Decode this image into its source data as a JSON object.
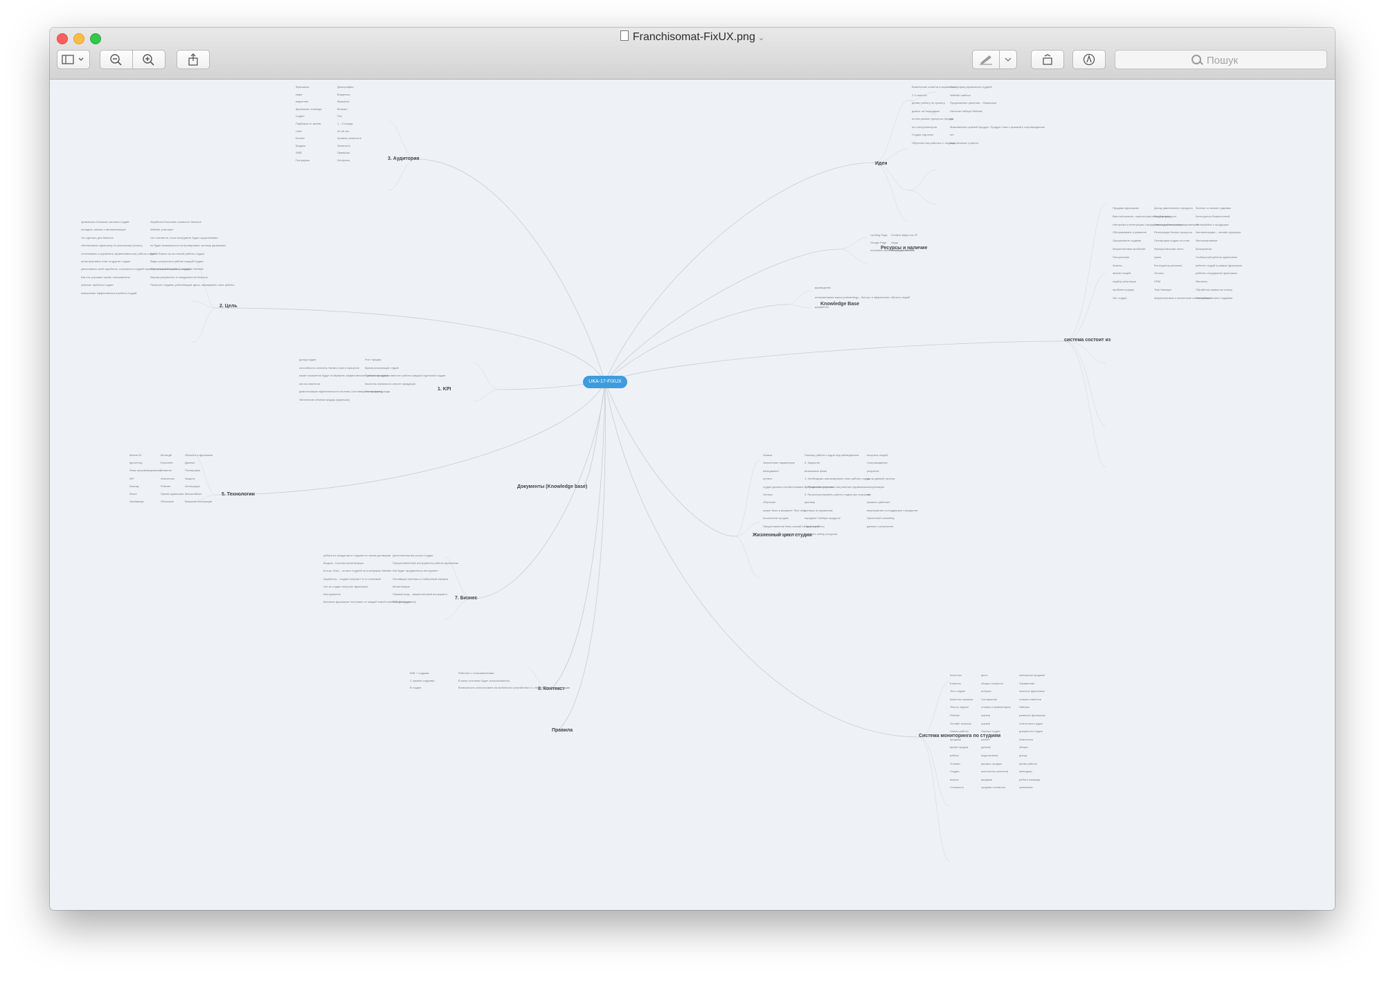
{
  "window": {
    "title": "Franchisomat-FixUX.png"
  },
  "search": {
    "placeholder": "Пошук"
  },
  "mindmap": {
    "center": "UKA-17-FIXUX",
    "main": {
      "idea": "Идея",
      "resources": "Ресурсы и наличие",
      "kb": "Knowledge Base",
      "system": "система состоит из",
      "lifecycle": "Жизненный цикл студии",
      "monitoring": "Система мониторинга по студиям",
      "auditory": "3. Аудитория",
      "goal": "2. Цель",
      "kpi": "1. KPI",
      "tech": "5. Технологии",
      "docs": "Документы (Knowledge base)",
      "business": "7. Бизнес",
      "context": "8. Контекст",
      "rules": "Правила"
    },
    "topics": {
      "idea": [
        "Вовлечение клиента в выражение",
        "2-3 клиента",
        "делает работу по проекту",
        "диалог на площадках",
        "не все разные процессы продаж",
        "нет консультаторов",
        "Студия под ключ",
        "Обучение как работать с людьми",
        "Платформа управления студией",
        "Website шаблон",
        "Продолжение решения – Франшиза",
        "Наличие наборы Website",
        "да",
        "Максимально краткий продукт; Продукт тоже с правкой к сопровождению",
        "нет",
        "подключение к работе"
      ],
      "resources": [
        "Landing Page",
        "Google Page",
        "основные записи на Front-end GS",
        "Готовое видео на JP",
        "Люди",
        "площадка Website"
      ],
      "kb": [
        "руководство",
        "интерактивная карта (onboarding) – быстро и эффективно обучить людей",
        "документы"
      ],
      "system": [
        "Продажа франшизы",
        "Ввести/показать, зарегистрировать доверие",
        "Настройка и интеграция стандартов студий на основе параметров",
        "Обслуживание и развитие",
        "Оформление студиям",
        "Маркетинговая проблема",
        "Поступление",
        "Анализ",
        "анализ людей",
        "подбор репутации",
        "проблем продаж",
        "Нет студии",
        "Доход фактического продукта",
        "Подбор продукта",
        "Заявка в планировщик",
        "Реализация бизнес-процесса",
        "Платформа студии по план",
        "Функциональная часть",
        "Цены",
        "Конструктор решения",
        "Оплата",
        "CRM",
        "Task Manager",
        "Маркетинговые и клиентские составляющие",
        "Контакт со всеми студиями",
        "Конструктор Вовлеченный",
        "Интерфейсы с продукции",
        "Автоматизация – онлайн-проверка",
        "Финансирование",
        "Калькулятор",
        "Глобальный рейтинг франчайзи",
        "рейтинг студий в рамках франшизы",
        "рейтинг сотрудников франшизы",
        "Финансы",
        "Обработка заявок на оплату",
        "Настройка оплаты студиями"
      ],
      "lifecycle": [
        "Заявка",
        "Заполнение параметров",
        "менеджмент",
        "оплата",
        "студия должна соответствовать требованиям качества",
        "Оплата",
        "Обучение",
        "может быть в формате \"Все-чём\"",
        "на качестве продаж",
        "Предоставление базы знаний по франшизе",
        "Оценка студии каждые сутки",
        "Помощь работы студии под наблюдением",
        "3. Закрытие",
        "возможные фазы",
        "1. Необходимо анализировать план работы студии за данный отрезок",
        "2. Продемонстрировать как работает франшиза",
        "3. Проконтролировать работу студии при открытии",
        "Договор",
        "договор по франшизе",
        "передача \"набора продукта\"",
        "Начало работы",
        "получить набор ресурсов",
        "получить людей",
        "Сопровождение",
        "результат",
        "да",
        "консультация",
        "нет",
        "правило работает",
        "мероприятия по поддержке стандартов",
        "Проектный consulting",
        "данные о результате"
      ],
      "monitoring": [
        "Качество",
        "Клиенты",
        "Тест студии",
        "Качество сервиса",
        "Тексты задачи",
        "Рейтинг",
        "Онлайн запросы",
        "Новые работы",
        "продажи",
        "время продаж",
        "работа",
        "Отзывы",
        "Студии",
        "вопрос",
        "Стоимость",
        "фото",
        "общая стоимость",
        "интерес",
        "Соглашение",
        "отзывы и комментарии",
        "оценка",
        "оценки",
        "Оценка студии",
        "расчёт",
        "данные",
        "подключение",
        "процесс продаж",
        "количество клиентов",
        "продажи",
        "средняя стоимость",
        "повторные продажи",
        "Управление",
        "клиенты франшизы",
        "отзывы клиентов",
        "Наборы",
        "развитие франшизы",
        "статистика студии",
        "документы студии",
        "Аналитика",
        "оборот",
        "доход",
        "время работы",
        "менеджер",
        "работа команды",
        "сравнение"
      ],
      "auditory": [
        "Франшиза",
        "кафе",
        "маркетинг",
        "франшиза, команда",
        "студия",
        "Подборка по целям",
        "Сайт",
        "Бизнес",
        "Модули",
        "SMB",
        "География",
        "Демография",
        "Владелец",
        "Мужчины",
        "Возраст",
        "Пол",
        "1 – 3 города",
        "25-45 лет",
        "Уровень занятости",
        "Занятость",
        "Привычки",
        "Интересы"
      ],
      "goal": [
        "привлекать большие системы студий",
        "наладить заказы и автоматизацию",
        "Что сделать для бизнеса",
        "обеспечивать франшизу по успешному проекту",
        "отслеживать и управлять эффективностью работы студий",
        "регистрировать этап на другие студии",
        "увеличивать свой заработок, становится студией приобретателем бизнеса с помощью Website",
        "Как это улучшает жизнь пользователя",
        "улучшит прибыль студии",
        "повышение эффективности работы студий",
        "Заработок Большая стоимость бизнеса",
        "Website участвует",
        "Что считается, если инструмент будет существовать",
        "не будет возможности контролировать систему франшизы",
        "Какой бизнес из-за плохой работы студии",
        "Видно результаты работы каждой студии",
        "Контролировать работу студий",
        "Каковы результаты от внедрения во бизнесе",
        "Помогать студиям, работающим здесь, наращивать опыт работы"
      ],
      "kpi": [
        "доход студии",
        "способность оплатить бизнес-план в процессе",
        "какие показатели будут отображать эффективность работы продукта",
        "кол-во клиентов",
        "демонстрация эффективности системы (поставщик по продаже)",
        "Увеличение объема продаж (франшиз)",
        "Рост продаж",
        "Время реализации студий",
        "Повышение эффективности работы каждой отдельной студии",
        "Качество сервиса по оплате продукции",
        "Увеличение дохода"
      ],
      "tech": [
        "MeteorJS",
        "фронтенд",
        "Язык программирования",
        "API",
        "Бэкенд",
        "React",
        "Фреймворк",
        "Монгодб",
        "Блокчейн",
        "Клиенты",
        "Аналитика",
        "Рейтинг",
        "Прием франшизы",
        "Облачные",
        "Объекты в франшизе",
        "Данные",
        "Платформа",
        "Защита",
        "Интеграция",
        "Масштабные",
        "Внешние интеграции"
      ],
      "business": [
        "работа по продуктам и студиям по своим договорам",
        "Модель. Система монетизации",
        "Кол-во Этап – оплата студией за платформу Website",
        "Заработок – студия получает % от платежей",
        "Что из студии получает франшиза",
        "Инструменты",
        "Выплаты франшизе поступают от каждой новой клиентской студии",
        "Дополнительные услуги студии",
        "Предоставленные инструменты работы франшизы",
        "Как будет продвигаться инструмент",
        "Поставщик системы и глобальный сервиса",
        "Монетизация",
        "Первый вход – маркетинговый инструмент",
        "B2B (pricing plans)"
      ],
      "context": [
        "B2B + студиям",
        "С какими студиями",
        "В студии",
        "Работает с пользователями",
        "В каких условиях будет использоваться",
        "Возможность использовать на мобильных устройствах и с любого девайса для студии"
      ]
    }
  }
}
